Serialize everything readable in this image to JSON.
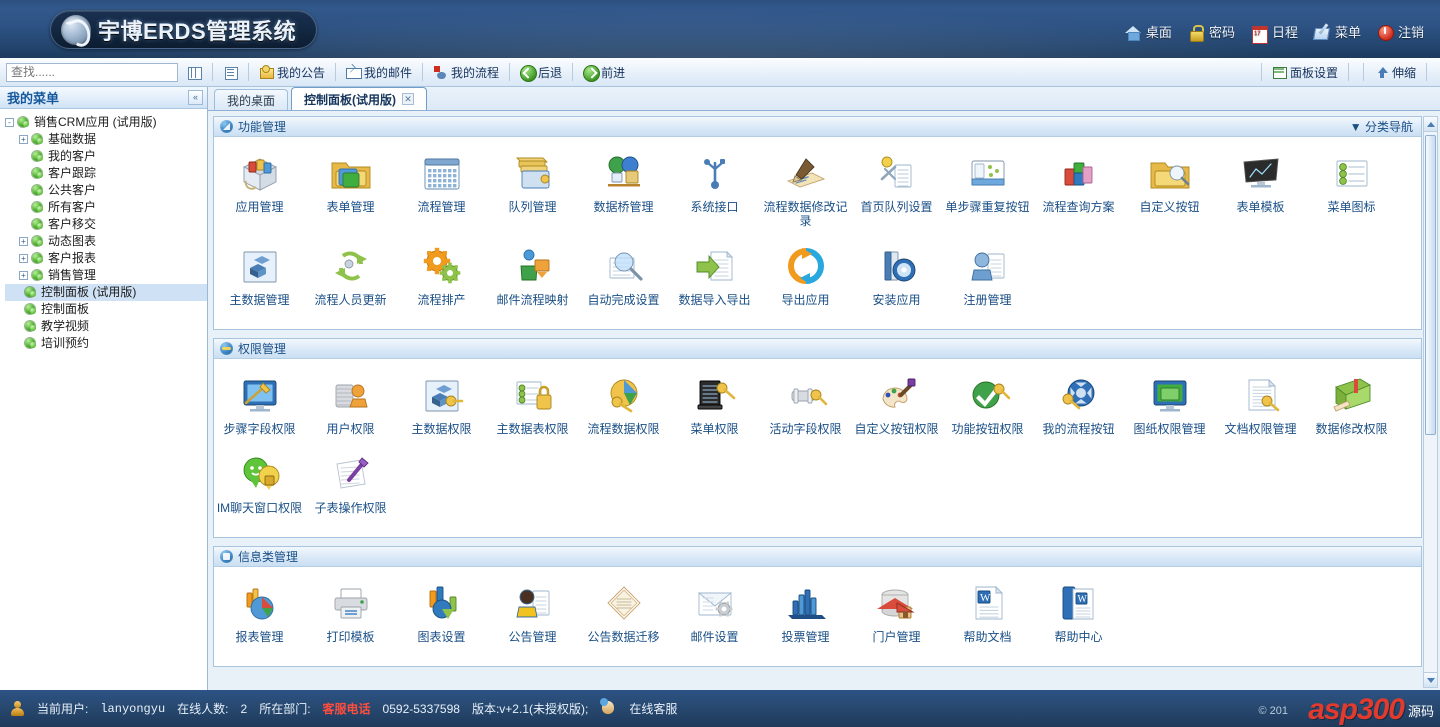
{
  "app": {
    "logo_text": "宇博ERDS管理系统",
    "logo_icon": "swoosh-logo-icon"
  },
  "topnav": [
    {
      "label": "桌面",
      "icon": "home-icon"
    },
    {
      "label": "密码",
      "icon": "lock-icon"
    },
    {
      "label": "日程",
      "icon": "calendar-icon"
    },
    {
      "label": "菜单",
      "icon": "menu-pen-icon"
    },
    {
      "label": "注销",
      "icon": "logout-icon"
    }
  ],
  "toolbar": {
    "search_placeholder": "查找......",
    "search_value": "",
    "buttons": [
      {
        "label": "",
        "icon": "tree-grid-icon"
      },
      {
        "label": "",
        "icon": "list-panel-icon"
      },
      {
        "label": "我的公告",
        "icon": "announcement-icon"
      },
      {
        "label": "我的邮件",
        "icon": "mail-icon"
      },
      {
        "label": "我的流程",
        "icon": "workflow-icon"
      },
      {
        "label": "后退",
        "icon": "back-arrow-icon"
      },
      {
        "label": "前进",
        "icon": "forward-arrow-icon"
      }
    ],
    "right_buttons": [
      {
        "label": "面板设置",
        "icon": "panel-settings-icon"
      },
      {
        "label": "伸缩",
        "icon": "expand-collapse-icon"
      }
    ]
  },
  "sidebar": {
    "title": "我的菜单",
    "collapse_label": "«",
    "tree": [
      {
        "label": "销售CRM应用 (试用版)",
        "depth": 0,
        "expander": "-",
        "selected": false
      },
      {
        "label": "基础数据",
        "depth": 1,
        "expander": "+",
        "selected": false
      },
      {
        "label": "我的客户",
        "depth": 1,
        "expander": "",
        "selected": false
      },
      {
        "label": "客户跟踪",
        "depth": 1,
        "expander": "",
        "selected": false
      },
      {
        "label": "公共客户",
        "depth": 1,
        "expander": "",
        "selected": false
      },
      {
        "label": "所有客户",
        "depth": 1,
        "expander": "",
        "selected": false
      },
      {
        "label": "客户移交",
        "depth": 1,
        "expander": "",
        "selected": false
      },
      {
        "label": "动态图表",
        "depth": 1,
        "expander": "+",
        "selected": false
      },
      {
        "label": "客户报表",
        "depth": 1,
        "expander": "+",
        "selected": false
      },
      {
        "label": "销售管理",
        "depth": 1,
        "expander": "+",
        "selected": false
      },
      {
        "label": "控制面板 (试用版)",
        "depth": 0.5,
        "expander": "",
        "selected": true
      },
      {
        "label": "控制面板",
        "depth": 0.5,
        "expander": "",
        "selected": false
      },
      {
        "label": "教学视频",
        "depth": 0.5,
        "expander": "",
        "selected": false
      },
      {
        "label": "培训预约",
        "depth": 0.5,
        "expander": "",
        "selected": false
      }
    ]
  },
  "tabs": [
    {
      "label": "我的桌面",
      "active": false,
      "closable": false
    },
    {
      "label": "控制面板(试用版)",
      "active": true,
      "closable": true
    }
  ],
  "groups": [
    {
      "title": "功能管理",
      "icon": "blue-arrow-circle-icon",
      "right_label": "▼ 分类导航",
      "items": [
        {
          "label": "应用管理",
          "icon": "app-box-icon",
          "c1": "#d94b3a",
          "c2": "#f0c34a",
          "c3": "#4f9ad6"
        },
        {
          "label": "表单管理",
          "icon": "form-folder-icon",
          "c1": "#4f9ad6",
          "c2": "#3fae3f",
          "c3": "#cfe0f0"
        },
        {
          "label": "流程管理",
          "icon": "calendar-grid-icon",
          "c1": "#6f9fd0",
          "c2": "#ffffff",
          "c3": "#3b6f9e"
        },
        {
          "label": "队列管理",
          "icon": "queue-books-icon",
          "c1": "#e2b84a",
          "c2": "#6f9fd0",
          "c3": "#d9a62f"
        },
        {
          "label": "数据桥管理",
          "icon": "data-bridge-globe-icon",
          "c1": "#3fa24a",
          "c2": "#3f7fd0",
          "c3": "#e0c27a"
        },
        {
          "label": "系统接口",
          "icon": "usb-interface-icon",
          "c1": "#4a7db5",
          "c2": "#6f9fd0",
          "c3": "#2f5e96"
        },
        {
          "label": "流程数据修改记录",
          "icon": "signature-pen-icon",
          "c1": "#c4a06a",
          "c2": "#f0e2b8",
          "c3": "#6b4a28"
        },
        {
          "label": "首页队列设置",
          "icon": "page-tools-icon",
          "c1": "#f2d24a",
          "c2": "#ffffff",
          "c3": "#8fa6bd"
        },
        {
          "label": "单步骤重复按钮",
          "icon": "step-repeat-button-icon",
          "c1": "#cfe0f0",
          "c2": "#4f9ad6",
          "c3": "#8fc24a"
        },
        {
          "label": "流程查询方案",
          "icon": "flow-query-blocks-icon",
          "c1": "#d94b3a",
          "c2": "#3fae3f",
          "c3": "#e5a0c8"
        },
        {
          "label": "自定义按钮",
          "icon": "folder-search-icon",
          "c1": "#f0c34a",
          "c2": "#cfe0f0",
          "c3": "#9fb6cf"
        },
        {
          "label": "表单模板",
          "icon": "monitor-template-icon",
          "c1": "#2b2b2b",
          "c2": "#b9c7d4",
          "c3": "#6f9fd0"
        },
        {
          "label": "菜单图标",
          "icon": "menu-icon-list-icon",
          "c1": "#8fc24a",
          "c2": "#ffffff",
          "c3": "#b9c7d4"
        },
        {
          "label": "主数据管理",
          "icon": "master-data-cubes-icon",
          "c1": "#4a7db5",
          "c2": "#cfe0f0",
          "c3": "#2f5e96"
        },
        {
          "label": "流程人员更新",
          "icon": "refresh-people-icon",
          "c1": "#8fc24a",
          "c2": "#b9c7d4",
          "c3": "#5a9e2f"
        },
        {
          "label": "流程排产",
          "icon": "gears-icon",
          "c1": "#f09a1e",
          "c2": "#8fc24a",
          "c3": "#d97f12"
        },
        {
          "label": "邮件流程映射",
          "icon": "mail-flow-map-icon",
          "c1": "#3fa24a",
          "c2": "#f09a1e",
          "c3": "#4a7db5"
        },
        {
          "label": "自动完成设置",
          "icon": "magnifier-page-icon",
          "c1": "#6f9fd0",
          "c2": "#ffffff",
          "c3": "#9fb6cf"
        },
        {
          "label": "数据导入导出",
          "icon": "import-export-icon",
          "c1": "#8fc24a",
          "c2": "#ffffff",
          "c3": "#5a9e2f"
        },
        {
          "label": "导出应用",
          "icon": "sync-circle-icon",
          "c1": "#f09a1e",
          "c2": "#29a8df",
          "c3": "#f09a1e"
        },
        {
          "label": "安装应用",
          "icon": "cd-install-icon",
          "c1": "#4a7db5",
          "c2": "#1f4f86",
          "c3": "#cfe0f0"
        },
        {
          "label": "注册管理",
          "icon": "user-register-icon",
          "c1": "#6f9fd0",
          "c2": "#ffffff",
          "c3": "#4a7db5"
        }
      ]
    },
    {
      "title": "权限管理",
      "icon": "key-circle-icon",
      "right_label": "",
      "items": [
        {
          "label": "步骤字段权限",
          "icon": "step-field-permission-icon",
          "c1": "#2f6fb5",
          "c2": "#cfe0f0",
          "c3": "#f0c34a"
        },
        {
          "label": "用户权限",
          "icon": "user-lock-icon",
          "c1": "#c9cdd2",
          "c2": "#f09a1e",
          "c3": "#8f959b"
        },
        {
          "label": "主数据权限",
          "icon": "master-data-key-icon",
          "c1": "#c9cdd2",
          "c2": "#f0c34a",
          "c3": "#2f7bbe"
        },
        {
          "label": "主数据表权限",
          "icon": "data-table-lock-icon",
          "c1": "#ffffff",
          "c2": "#e2b84a",
          "c3": "#8fc24a"
        },
        {
          "label": "流程数据权限",
          "icon": "pie-key-icon",
          "c1": "#f0c34a",
          "c2": "#3fa24a",
          "c3": "#4f9ad6"
        },
        {
          "label": "菜单权限",
          "icon": "menu-key-icon",
          "c1": "#2b2b2b",
          "c2": "#f0c34a",
          "c3": "#b9c7d4"
        },
        {
          "label": "活动字段权限",
          "icon": "field-key-icon",
          "c1": "#c9cdd2",
          "c2": "#f0c34a",
          "c3": "#8f959b"
        },
        {
          "label": "自定义按钮权限",
          "icon": "palette-key-icon",
          "c1": "#f0e2b8",
          "c2": "#7a3fa2",
          "c3": "#d94b3a"
        },
        {
          "label": "功能按钮权限",
          "icon": "check-key-icon",
          "c1": "#3fa24a",
          "c2": "#f0c34a",
          "c3": "#2f7a2f"
        },
        {
          "label": "我的流程按钮",
          "icon": "flow-key-wheel-icon",
          "c1": "#2f6fb5",
          "c2": "#f0c34a",
          "c3": "#cfe0f0"
        },
        {
          "label": "图纸权限管理",
          "icon": "drawing-window-icon",
          "c1": "#4f9ad6",
          "c2": "#3fae3f",
          "c3": "#cfe0f0"
        },
        {
          "label": "文档权限管理",
          "icon": "document-key-icon",
          "c1": "#ffffff",
          "c2": "#f0c34a",
          "c3": "#9fb6cf"
        },
        {
          "label": "数据修改权限",
          "icon": "green-book-edit-icon",
          "c1": "#8fc24a",
          "c2": "#d94b3a",
          "c3": "#f0e2b8"
        },
        {
          "label": "IM聊天窗口权限",
          "icon": "chat-lock-icon",
          "c1": "#5fc43a",
          "c2": "#f2d24a",
          "c3": "#b8860b"
        },
        {
          "label": "子表操作权限",
          "icon": "subtable-pen-icon",
          "c1": "#ffffff",
          "c2": "#7a3fa2",
          "c3": "#cfd6de"
        }
      ]
    },
    {
      "title": "信息类管理",
      "icon": "info-list-icon",
      "right_label": "",
      "items": [
        {
          "label": "报表管理",
          "icon": "report-chart-icon",
          "c1": "#f09a1e",
          "c2": "#4f9ad6",
          "c3": "#d94b3a"
        },
        {
          "label": "打印模板",
          "icon": "printer-icon",
          "c1": "#c9cdd2",
          "c2": "#ffffff",
          "c3": "#4f9ad6"
        },
        {
          "label": "图表设置",
          "icon": "bar-chart-settings-icon",
          "c1": "#f09a1e",
          "c2": "#2f7bbe",
          "c3": "#8fc24a"
        },
        {
          "label": "公告管理",
          "icon": "announcer-person-icon",
          "c1": "#f2c21e",
          "c2": "#4a3020",
          "c3": "#e8a06a"
        },
        {
          "label": "公告数据迁移",
          "icon": "clipboard-migrate-icon",
          "c1": "#c4a06a",
          "c2": "#ffffff",
          "c3": "#9fb6cf"
        },
        {
          "label": "邮件设置",
          "icon": "mail-settings-icon",
          "c1": "#ffffff",
          "c2": "#9fb6cf",
          "c3": "#c9cdd2"
        },
        {
          "label": "投票管理",
          "icon": "vote-bars-icon",
          "c1": "#2f6fb5",
          "c2": "#4f9ad6",
          "c3": "#1f4f86"
        },
        {
          "label": "门户管理",
          "icon": "portal-house-icon",
          "c1": "#d9d9d9",
          "c2": "#d94b3a",
          "c3": "#c4a06a"
        },
        {
          "label": "帮助文档",
          "icon": "word-doc-icon",
          "c1": "#ffffff",
          "c2": "#2f6fb5",
          "c3": "#9fb6cf"
        },
        {
          "label": "帮助中心",
          "icon": "word-help-icon",
          "c1": "#2f6fb5",
          "c2": "#ffffff",
          "c3": "#1f4f86"
        }
      ]
    }
  ],
  "statusbar": {
    "user_label": "当前用户:",
    "user_name": "lanyongyu",
    "online_label": "在线人数:",
    "online_count": "2",
    "dept_label": "所在部门:",
    "service_label": "客服电话",
    "service_phone": "0592-5337598",
    "version": "版本:v+2.1(未授权版);",
    "online_service": "在线客服",
    "brand_main": "asp",
    "brand_num": "300",
    "brand_cn": "源码",
    "copyright": "© 201"
  }
}
